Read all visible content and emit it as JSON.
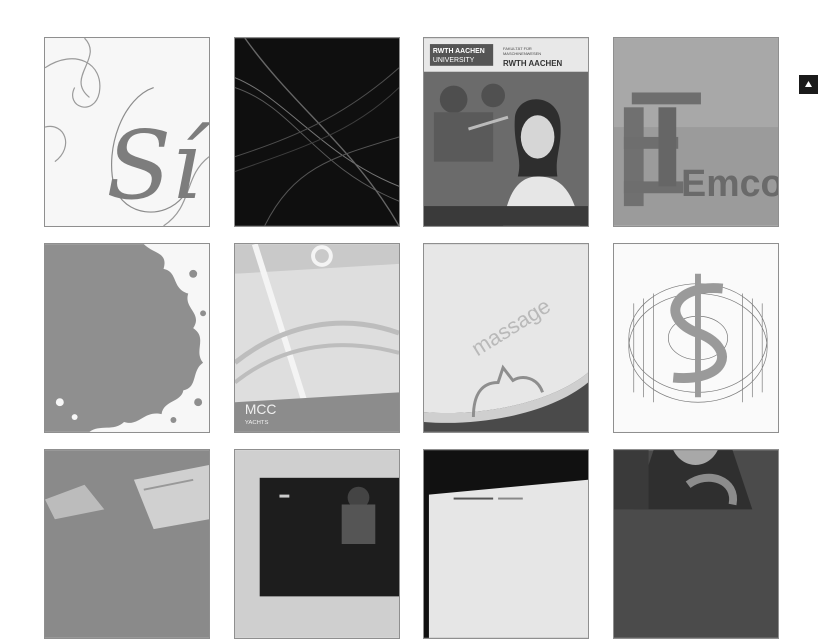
{
  "colors": {
    "background": "#ffffff",
    "tile_border": "#8f8f8f",
    "scroll_button": "#1a1a1a"
  },
  "scroll_top": {
    "icon": "triangle-up-icon"
  },
  "portfolio": {
    "tiles": [
      {
        "name": "script-si-tile",
        "text": "Sí"
      },
      {
        "name": "abstract-light-waves-tile"
      },
      {
        "name": "rwth-aachen-brochure-tile",
        "logo_left_1": "RWTH AACHEN",
        "logo_left_2": "UNIVERSITY",
        "faculty_1": "FAKULTÄT FÜR",
        "faculty_2": "MASCHINENWESEN",
        "logo_right": "RWTH AACHEN"
      },
      {
        "name": "emco-signage-tile",
        "text": "Emco"
      },
      {
        "name": "splash-shape-tile"
      },
      {
        "name": "mcc-yachts-tile",
        "title": "MCC",
        "subtitle": "YACHTS"
      },
      {
        "name": "massage-card-tile",
        "text": "massage"
      },
      {
        "name": "dollar-gear-tile"
      },
      {
        "name": "paper-stack-tile"
      },
      {
        "name": "monitor-portrait-tile"
      },
      {
        "name": "dark-screen-tile"
      },
      {
        "name": "person-tshirt-tile"
      }
    ]
  }
}
